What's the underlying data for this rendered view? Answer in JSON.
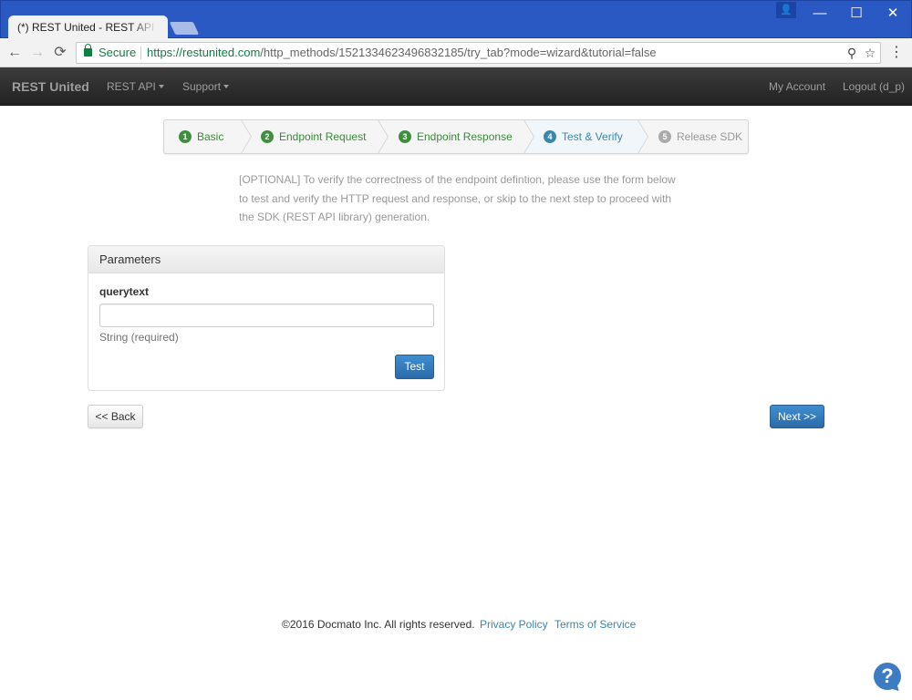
{
  "browser": {
    "tab_title": "(*) REST United - REST API n",
    "tab_close": "×",
    "secure_label": "Secure",
    "url_host": "https://restunited.com",
    "url_path": "/http_methods/1521334623496832185/try_tab?mode=wizard&tutorial=false",
    "controls": {
      "minimize": "—",
      "maximize": "☐",
      "close": "✕",
      "profile": "👤"
    },
    "nav": {
      "back": "←",
      "forward": "→",
      "reload": "⟳",
      "zoom": "⚲",
      "star": "☆",
      "menu": "⋮"
    }
  },
  "navbar": {
    "brand": "REST United",
    "rest_api": "REST API",
    "support": "Support",
    "my_account": "My Account",
    "logout": "Logout (d_p)"
  },
  "wizard": {
    "steps": [
      {
        "num": "1",
        "label": "Basic",
        "state": "done"
      },
      {
        "num": "2",
        "label": "Endpoint Request",
        "state": "done"
      },
      {
        "num": "3",
        "label": "Endpoint Response",
        "state": "done"
      },
      {
        "num": "4",
        "label": "Test & Verify",
        "state": "active"
      },
      {
        "num": "5",
        "label": "Release SDK",
        "state": "future"
      }
    ]
  },
  "intro_text": "[OPTIONAL] To verify the correctness of the endpoint defintion, please use the form below to test and verify the HTTP request and response, or skip to the next step to proceed with the SDK (REST API library) generation.",
  "parameters": {
    "title": "Parameters",
    "field_label": "querytext",
    "field_value": "",
    "field_help": "String (required)",
    "test_button": "Test"
  },
  "back_button": "<< Back",
  "next_button": "Next >>",
  "footer": {
    "copyright": "©2016 Docmato Inc. All rights reserved.",
    "privacy": "Privacy Policy",
    "terms": "Terms of Service"
  },
  "help_icon": "?",
  "colors": {
    "titlebar": "#2b59c3",
    "navbar": "#222222",
    "accent_blue": "#3a87ad",
    "done_green": "#3f8f3f",
    "button_blue": "#2c6aa8"
  }
}
